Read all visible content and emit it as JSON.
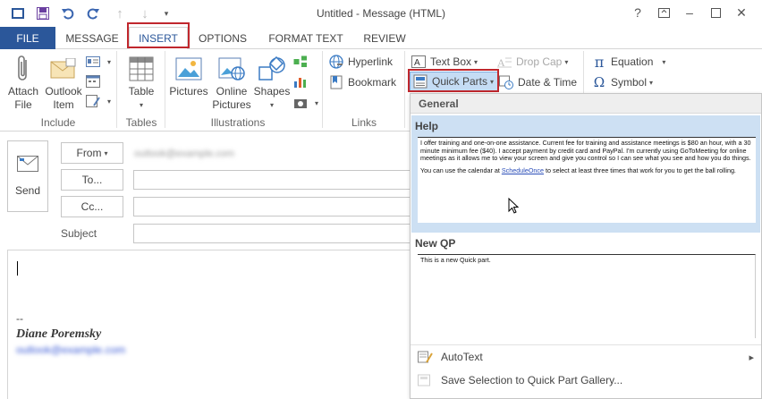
{
  "window": {
    "title": "Untitled - Message (HTML)",
    "help_glyph": "?",
    "restore_glyph": "□",
    "minimize_glyph": "–",
    "maximize_glyph": "▢",
    "close_glyph": "✕"
  },
  "quick_access": [
    "save-icon",
    "undo-icon",
    "redo-icon",
    "up-icon",
    "down-icon",
    "customize-icon"
  ],
  "tabs": [
    "FILE",
    "MESSAGE",
    "INSERT",
    "OPTIONS",
    "FORMAT TEXT",
    "REVIEW"
  ],
  "active_tab": "INSERT",
  "ribbon": {
    "include": {
      "label": "Include",
      "attach": "Attach File",
      "attach_l1": "Attach",
      "attach_l2": "File",
      "outlook_l1": "Outlook",
      "outlook_l2": "Item"
    },
    "tables": {
      "label": "Tables",
      "table": "Table"
    },
    "illustrations": {
      "label": "Illustrations",
      "pictures": "Pictures",
      "online_l1": "Online",
      "online_l2": "Pictures",
      "shapes": "Shapes"
    },
    "links": {
      "label": "Links",
      "hyperlink": "Hyperlink",
      "bookmark": "Bookmark"
    },
    "text": {
      "text_box": "Text Box",
      "drop_cap": "Drop Cap",
      "quick_parts": "Quick Parts",
      "date_time": "Date & Time"
    },
    "symbols": {
      "equation": "Equation",
      "symbol": "Symbol"
    }
  },
  "message": {
    "send": "Send",
    "from": "From",
    "from_dd": "▾",
    "from_value": "outlook@example.com",
    "to": "To...",
    "cc": "Cc...",
    "subject": "Subject",
    "sig_dash": "--",
    "sig_name": "Diane Poremsky",
    "sig_email": "outlook@example.com"
  },
  "gallery": {
    "header": "General",
    "parts": [
      {
        "name": "Help",
        "preview_p1": "I offer training and one-on-one assistance. Current fee for training and assistance meetings is $80 an hour, with a 30 minute minimum fee ($40). I accept payment by credit card and PayPal. I'm currently using GoToMeeting for online meetings as it allows me to view your screen and give you control so I can see what you see and how you do things.",
        "preview_p2a": "You can use the calendar at ",
        "preview_link": "ScheduleOnce",
        "preview_p2b": " to select at least three times that work for you to get the ball rolling."
      },
      {
        "name": "New QP",
        "preview_p1": "This is a new Quick part."
      }
    ],
    "menu": {
      "autotext": "AutoText",
      "autotext_arrow": "▸",
      "save_selection": "Save Selection to Quick Part Gallery..."
    }
  }
}
